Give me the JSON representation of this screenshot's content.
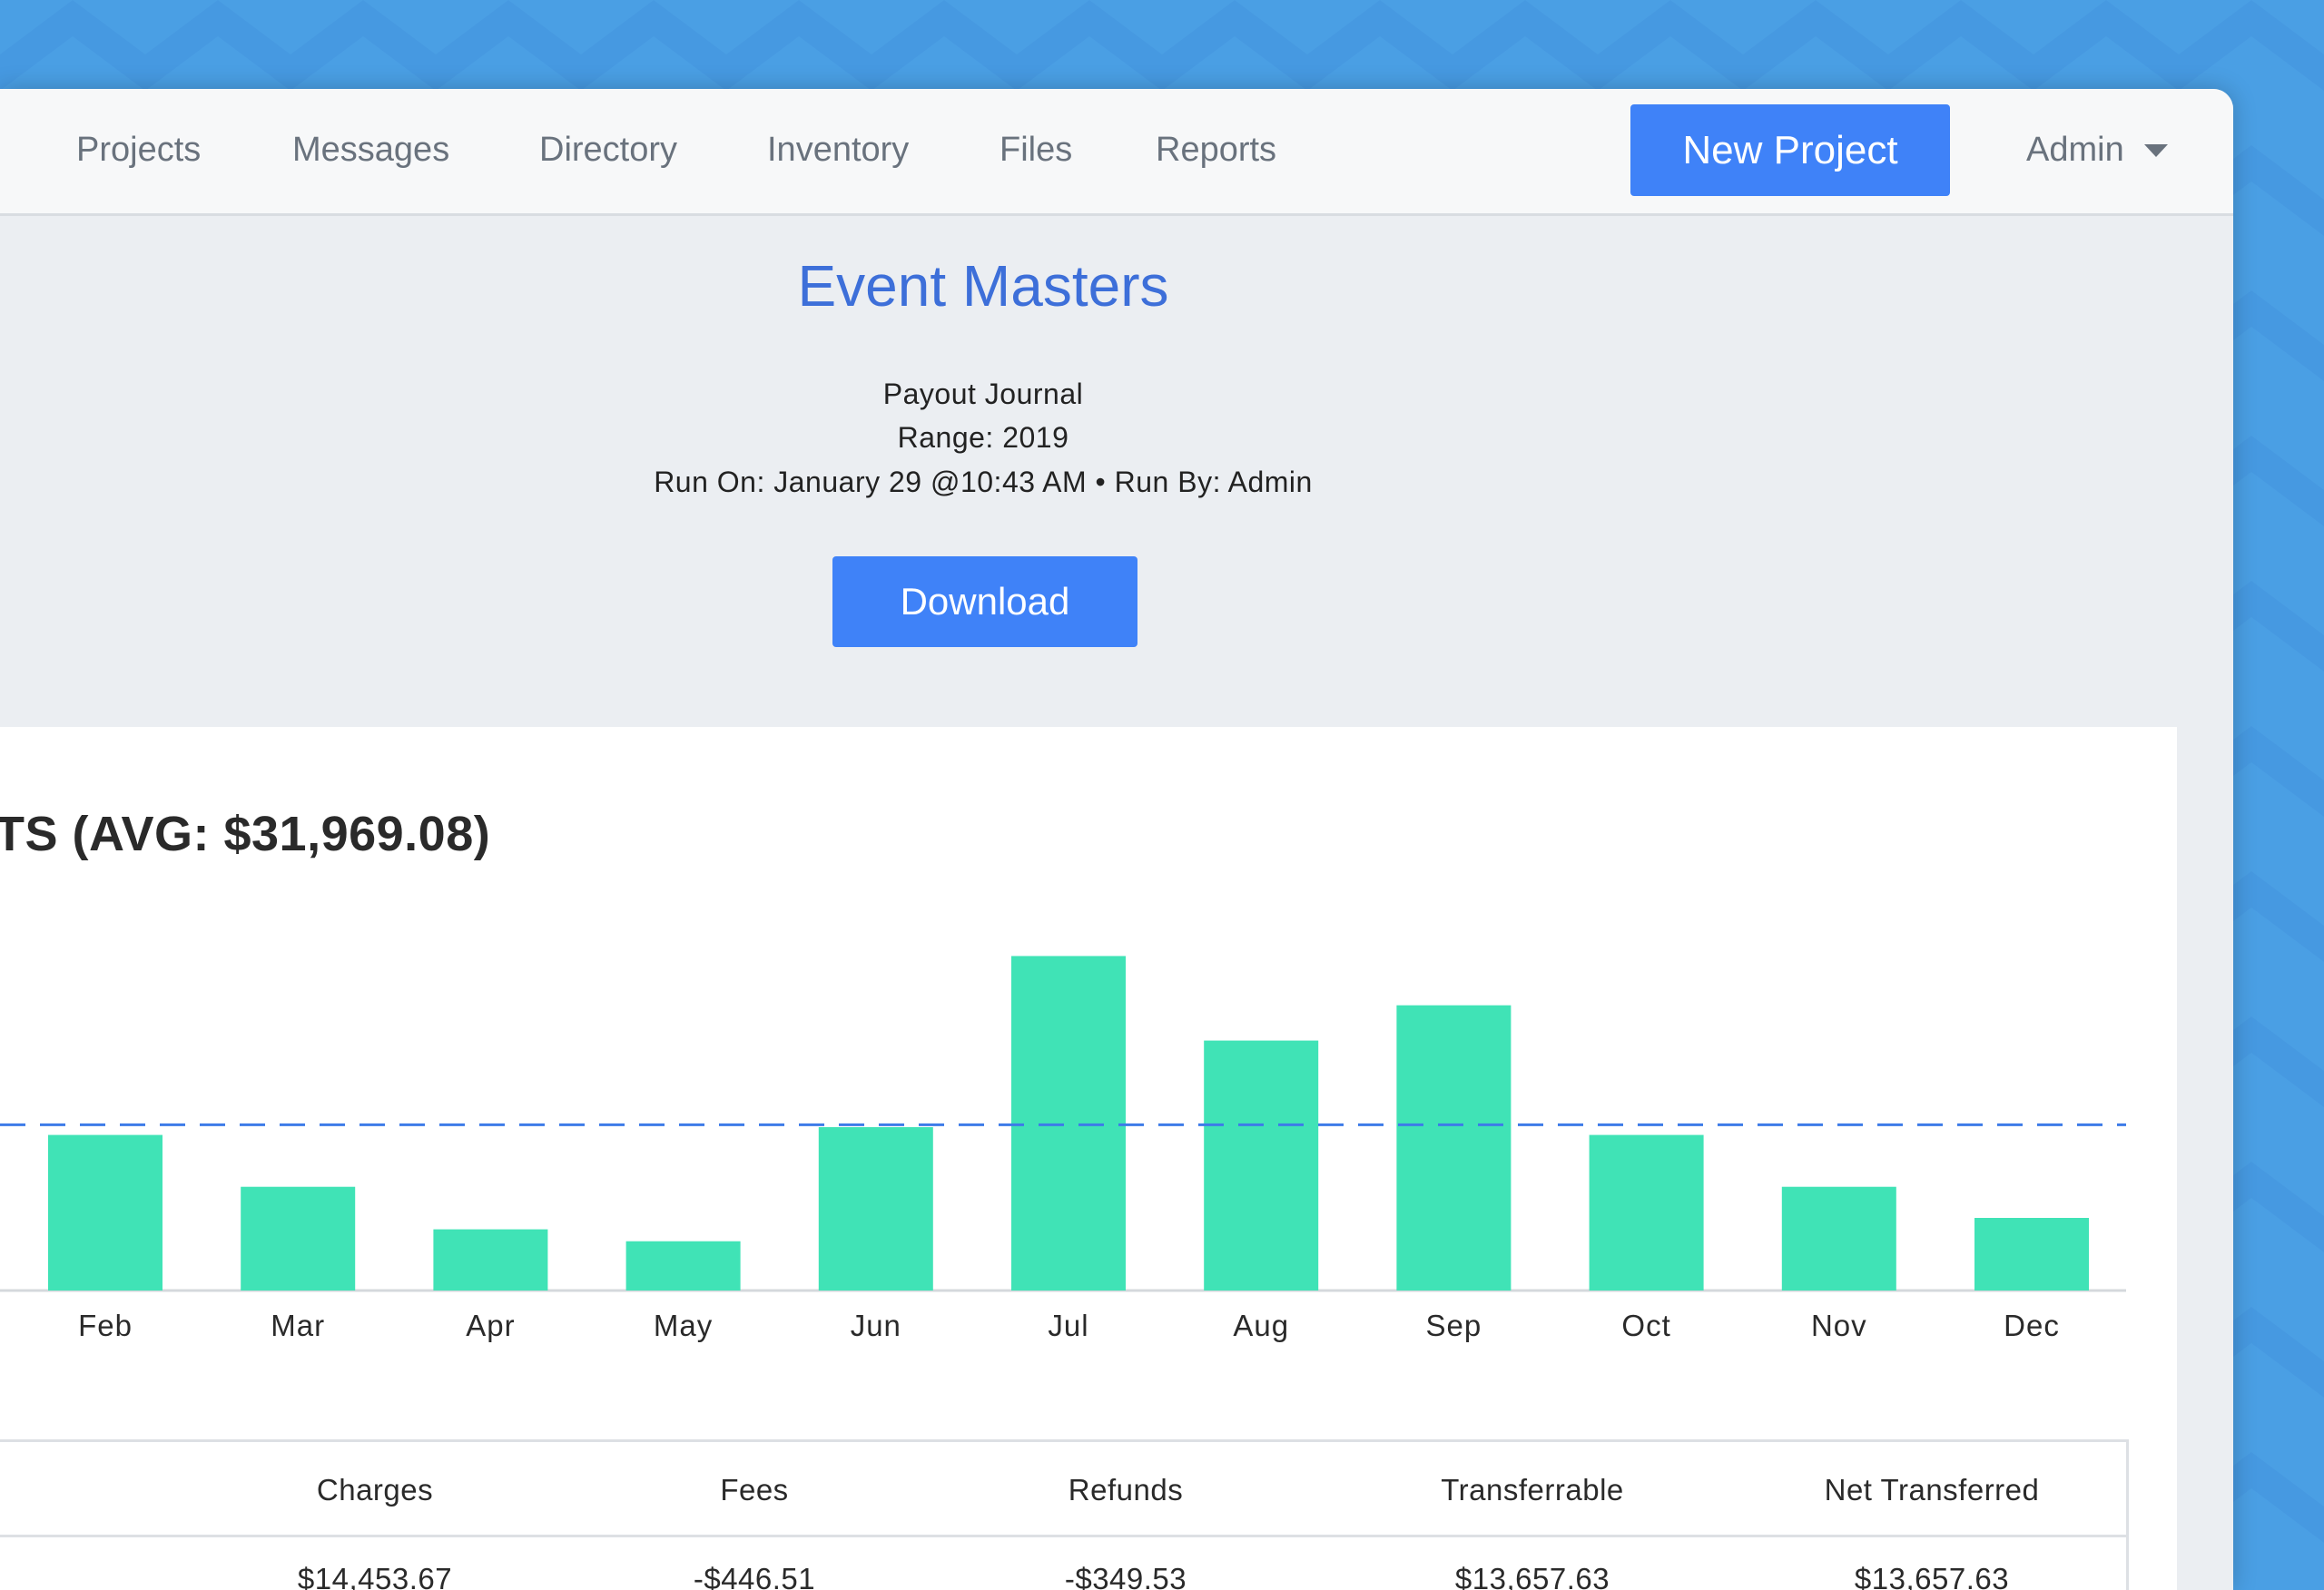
{
  "nav": {
    "items": [
      "Projects",
      "Messages",
      "Directory",
      "Inventory",
      "Files",
      "Reports"
    ],
    "new_project_label": "New Project",
    "user_label": "Admin"
  },
  "report": {
    "title": "Event Masters",
    "subtitle": "Payout Journal",
    "range": "Range: 2019",
    "run_info": "Run On: January 29 @10:43 AM • Run By: Admin",
    "download_label": "Download"
  },
  "chart_title": "TS (AVG: $31,969.08)",
  "colors": {
    "background": "#4a9fe4",
    "accent": "#3f82f8",
    "title": "#3d6fd9",
    "bar": "#40e3b6",
    "avg_line": "#3d7be8"
  },
  "chart_data": {
    "type": "bar",
    "title": "TS (AVG: $31,969.08)",
    "categories": [
      "Feb",
      "Mar",
      "Apr",
      "May",
      "Jun",
      "Jul",
      "Aug",
      "Sep",
      "Oct",
      "Nov",
      "Dec"
    ],
    "values": [
      30000,
      20000,
      11800,
      9500,
      31500,
      64500,
      48200,
      55000,
      30000,
      20000,
      14000
    ],
    "reference_line": {
      "label": "AVG",
      "value": 31969.08,
      "style": "dashed"
    },
    "ylim": [
      0,
      70000
    ],
    "grid": false
  },
  "table": {
    "headers": [
      "Charges",
      "Fees",
      "Refunds",
      "Transferrable",
      "Net Transferred"
    ],
    "rows": [
      [
        "$14,453.67",
        "-$446.51",
        "-$349.53",
        "$13,657.63",
        "$13,657.63"
      ]
    ]
  }
}
